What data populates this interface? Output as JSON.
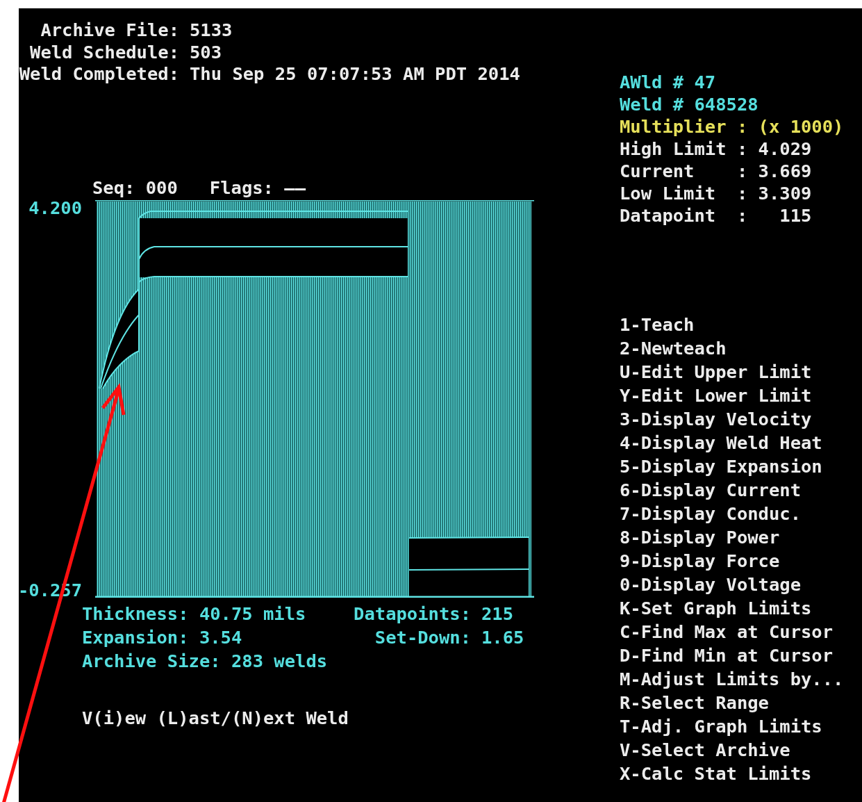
{
  "header": [
    {
      "label": "Archive File:",
      "value": "5133"
    },
    {
      "label": "Weld Schedule:",
      "value": "503"
    },
    {
      "label": "Weld Completed:",
      "value": "Thu Sep 25 07:07:53 AM PDT 2014"
    }
  ],
  "chart": {
    "seq": "Seq: 000",
    "flags": "Flags: ——",
    "y_max": "4.200",
    "y_min": "-0.257"
  },
  "stats_left": [
    "Thickness: 40.75 mils",
    "Expansion: 3.54",
    "Archive Size: 283 welds"
  ],
  "stats_right": [
    {
      "label": "Datapoints:",
      "value": "215"
    },
    {
      "label": "Set-Down:",
      "value": "1.65"
    }
  ],
  "prompt": "V(i)ew (L)ast/(N)ext Weld",
  "info": [
    {
      "text": "AWld # 47",
      "color": "#55dede"
    },
    {
      "text": "Weld # 648528",
      "color": "#55dede"
    },
    {
      "text": "Multiplier : (x 1000)",
      "color": "#e6e05a"
    },
    {
      "text": "High Limit : 4.029",
      "color": "#ececec"
    },
    {
      "text": "Current    : 3.669",
      "color": "#ececec"
    },
    {
      "text": "Low Limit  : 3.309",
      "color": "#ececec"
    },
    {
      "text": "Datapoint  :   115",
      "color": "#ececec"
    }
  ],
  "menu": [
    "1-Teach",
    "2-Newteach",
    "U-Edit Upper Limit",
    "Y-Edit Lower Limit",
    "3-Display Velocity",
    "4-Display Weld Heat",
    "5-Display Expansion",
    "6-Display Current",
    "7-Display Conduc.",
    "8-Display Power",
    "9-Display Force",
    "0-Display Voltage",
    "K-Set Graph Limits",
    "C-Find Max at Cursor",
    "D-Find Min at Cursor",
    "M-Adjust Limits by...",
    "R-Select Range",
    "T-Adj. Graph Limits",
    "V-Select Archive",
    "X-Calc Stat Limits"
  ]
}
